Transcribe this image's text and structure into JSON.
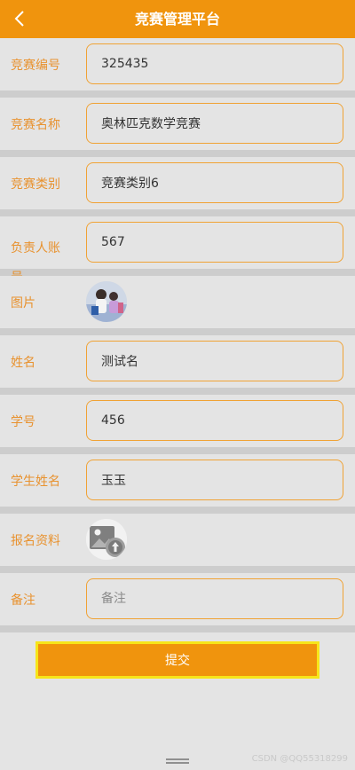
{
  "header": {
    "title": "竞赛管理平台",
    "back_icon": "chevron-left-icon"
  },
  "form": {
    "competition_no": {
      "label": "竞赛编号",
      "value": "325435"
    },
    "competition_name": {
      "label": "竞赛名称",
      "value": "奥林匹克数学竞赛"
    },
    "competition_category": {
      "label": "竞赛类别",
      "value": "竞赛类别6"
    },
    "owner_account": {
      "label": "负责人账号",
      "value": "567"
    },
    "image": {
      "label": "图片"
    },
    "name": {
      "label": "姓名",
      "value": "测试名"
    },
    "student_no": {
      "label": "学号",
      "value": "456"
    },
    "student_name": {
      "label": "学生姓名",
      "value": "玉玉"
    },
    "signup_materials": {
      "label": "报名资料"
    },
    "remark": {
      "label": "备注",
      "value": "",
      "placeholder": "备注"
    }
  },
  "submit_label": "提交",
  "watermark": "CSDN @QQ55318299",
  "colors": {
    "accent": "#f0940d",
    "label": "#e8922f",
    "border": "#f0a234",
    "submit_border": "#f7e51a"
  }
}
